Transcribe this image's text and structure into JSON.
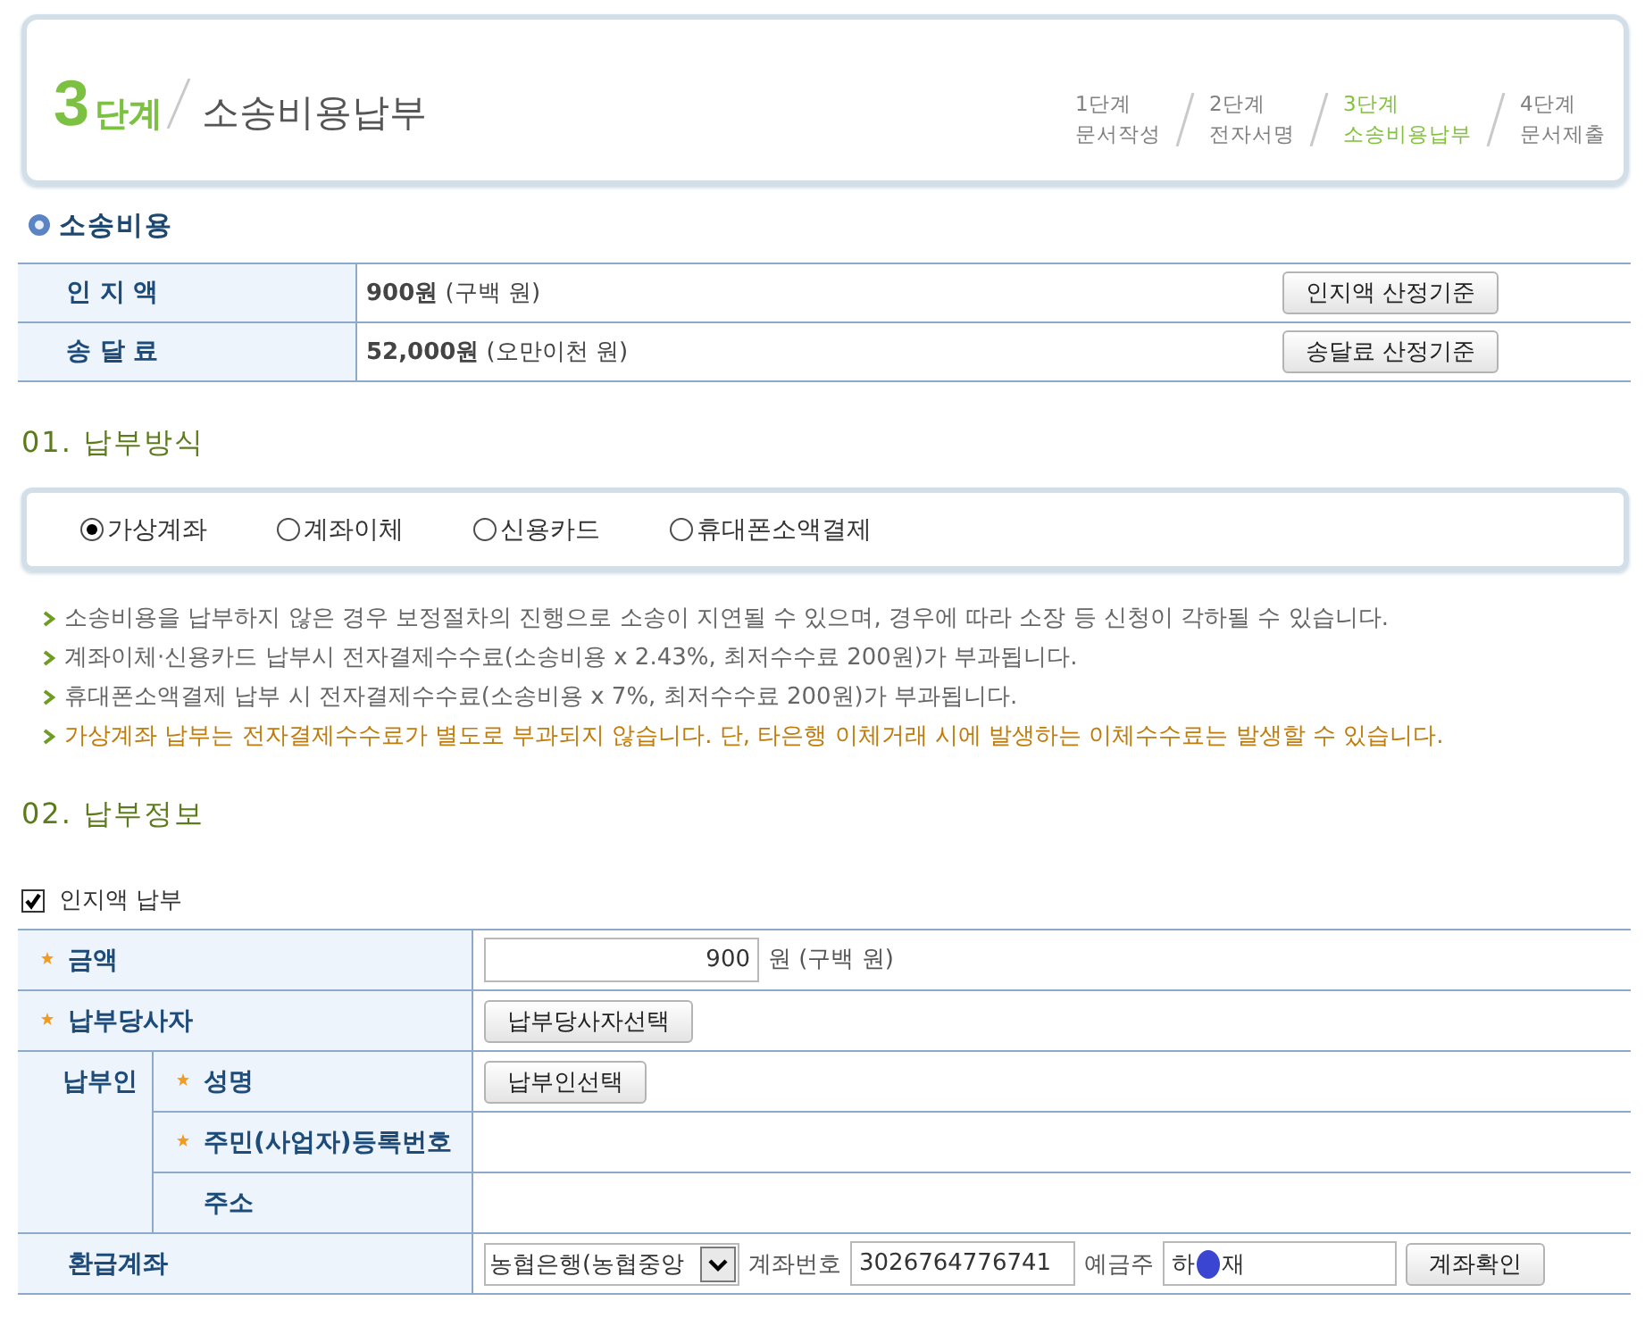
{
  "header": {
    "step_number": "3",
    "step_word": "단계",
    "title": "소송비용납부",
    "steps": [
      {
        "number": "1단계",
        "name": "문서작성",
        "selected": false
      },
      {
        "number": "2단계",
        "name": "전자서명",
        "selected": false
      },
      {
        "number": "3단계",
        "name": "소송비용납부",
        "selected": true
      },
      {
        "number": "4단계",
        "name": "문서제출",
        "selected": false
      }
    ]
  },
  "costs": {
    "heading": "소송비용",
    "rows": [
      {
        "label": "인 지 액",
        "value": "**900원** (구백 원)",
        "button": "인지액 산정기준"
      },
      {
        "label": "송 달 료",
        "value": "**52,000원** (오만이천 원)",
        "button": "송달료 산정기준"
      }
    ]
  },
  "payment_method": {
    "heading": "01. 납부방식",
    "options": [
      {
        "label": "가상계좌",
        "selected": true
      },
      {
        "label": "계좌이체",
        "selected": false
      },
      {
        "label": "신용카드",
        "selected": false
      },
      {
        "label": "휴대폰소액결제",
        "selected": false
      }
    ],
    "notes": [
      {
        "kind": "normal",
        "text": "소송비용을 납부하지 않은 경우 보정절차의 진행으로 소송이 지연될 수 있으며, 경우에 따라 소장 등 신청이 각하될 수 있습니다."
      },
      {
        "kind": "normal",
        "text": "계좌이체·신용카드 납부시 전자결제수수료(소송비용 x 2.43%, 최저수수료 200원)가 부과됩니다."
      },
      {
        "kind": "normal",
        "text": "휴대폰소액결제 납부 시 전자결제수수료(소송비용 x 7%, 최저수수료 200원)가 부과됩니다."
      },
      {
        "kind": "highlight",
        "text": "가상계좌 납부는 전자결제수수료가 별도로 부과되지 않습니다. 단, 타은행 이체거래 시에 발생하는 이체수수료는 발생할 수 있습니다."
      }
    ]
  },
  "payment_info": {
    "heading": "02. 납부정보",
    "stamp_payment": {
      "label": "인지액 납부",
      "checked": true
    },
    "rows": [
      {
        "kind": "amount",
        "label": "금액",
        "required": true,
        "value": "900",
        "words": "원 (구백 원)"
      },
      {
        "kind": "button",
        "label": "납부당사자",
        "required": true,
        "button": "납부당사자선택"
      },
      {
        "kind": "group",
        "label": "납부인",
        "children": [
          {
            "kind": "button",
            "label": "성명",
            "required": true,
            "button": "납부인선택"
          },
          {
            "kind": "empty",
            "label": "주민(사업자)등록번호",
            "required": true
          },
          {
            "kind": "empty",
            "label": "주소",
            "required": false
          }
        ]
      },
      {
        "kind": "refund_account",
        "label": "환급계좌",
        "required": false,
        "bank": "농협은행(농협중앙",
        "account_label": "계좌번호",
        "account_number": "3026764776741",
        "holder_label": "예금주",
        "holder_parts": [
          "하",
          "재"
        ],
        "button": "계좌확인"
      }
    ]
  }
}
